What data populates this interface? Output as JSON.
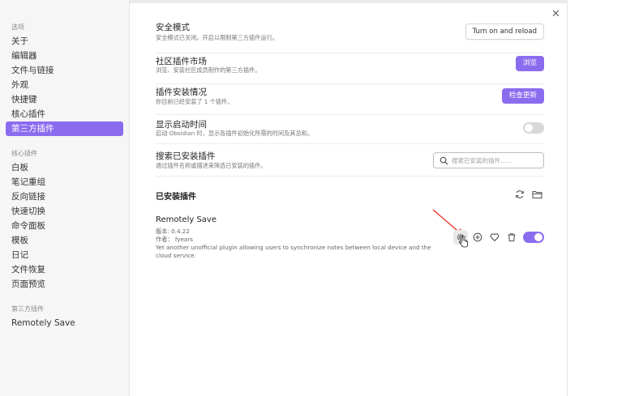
{
  "sidebar": {
    "options_heading": "选项",
    "options_items": [
      "关于",
      "编辑器",
      "文件与链接",
      "外观",
      "快捷键",
      "核心插件",
      "第三方插件"
    ],
    "core_heading": "核心插件",
    "core_items": [
      "白板",
      "笔记重组",
      "反向链接",
      "快速切换",
      "命令面板",
      "模板",
      "日记",
      "文件恢复",
      "页面预览"
    ],
    "third_heading": "第三方插件",
    "third_items": [
      "Remotely Save"
    ]
  },
  "settings": {
    "safe_mode": {
      "name": "安全模式",
      "desc": "安全模式已关闭。开启以限制第三方插件运行。",
      "button": "Turn on and reload"
    },
    "market": {
      "name": "社区插件市场",
      "desc": "浏览、安装社区成员制作的第三方插件。",
      "button": "浏览"
    },
    "installed": {
      "name": "插件安装情况",
      "desc": "你目前已经安装了 1 个插件。",
      "button": "检查更新"
    },
    "startup": {
      "name": "显示启动时间",
      "desc": "启动 Obsidian 时，显示各插件初始化所需的时间及其总和。",
      "enabled": false
    },
    "search": {
      "name": "搜索已安装插件",
      "desc": "通过插件名称或描述来筛选已安装的插件。",
      "placeholder": "搜索已安装的插件......"
    }
  },
  "installed_section": {
    "title": "已安装插件"
  },
  "plugin": {
    "name": "Remotely Save",
    "version": "版本: 0.4.22",
    "author": "作者： fyears",
    "description": "Yet another unofficial plugin allowing users to synchronize notes between local device and the cloud service.",
    "enabled": true
  },
  "colors": {
    "accent": "#8b6cef",
    "annotation_arrow": "#e8382f"
  }
}
